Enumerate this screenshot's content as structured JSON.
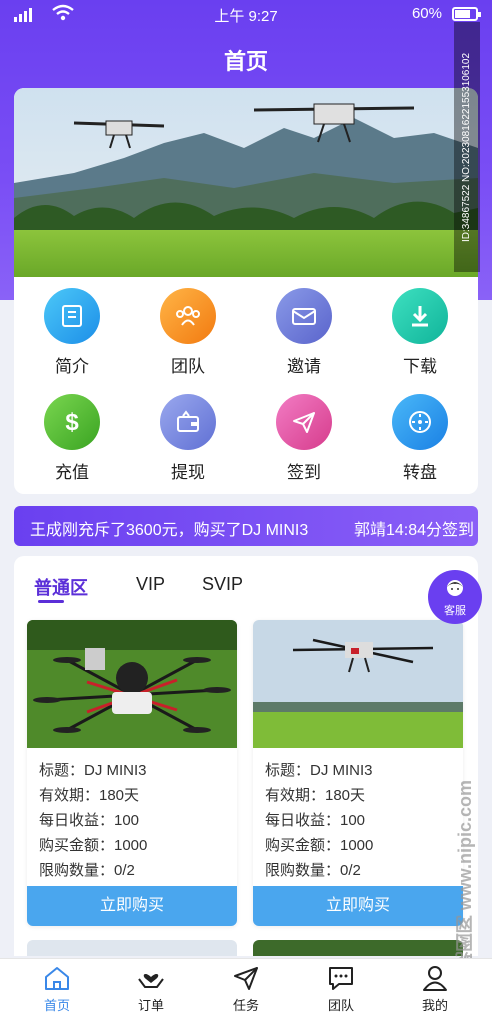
{
  "status_bar": {
    "time": "上午 9:27",
    "battery": "60%"
  },
  "page_title": "首页",
  "grid_items": [
    {
      "label": "简介",
      "icon": "document-icon",
      "color": "#29aaf0"
    },
    {
      "label": "团队",
      "icon": "team-icon",
      "color": "#f59a1e"
    },
    {
      "label": "邀请",
      "icon": "mail-icon",
      "color": "#6c7bd8"
    },
    {
      "label": "下载",
      "icon": "download-icon",
      "color": "#22ccb0"
    },
    {
      "label": "充值",
      "icon": "dollar-icon",
      "color": "#5cc43a"
    },
    {
      "label": "提现",
      "icon": "wallet-icon",
      "color": "#7b8ee0"
    },
    {
      "label": "签到",
      "icon": "send-icon",
      "color": "#e055a4"
    },
    {
      "label": "转盘",
      "icon": "wheel-icon",
      "color": "#2f9cf0"
    }
  ],
  "ticker": {
    "text1": "王成刚充斥了3600元，购买了DJ MINI3",
    "text2": "郭靖14:84分签到"
  },
  "tabs": [
    "普通区",
    "VIP",
    "SVIP"
  ],
  "products": [
    {
      "title": "标题：DJ MINI3",
      "validity": "有效期：180天",
      "daily": "每日收益：100",
      "amount": "购买金额：1000",
      "limit": "限购数量：0/2",
      "button": "立即购买"
    },
    {
      "title": "标题：DJ MINI3",
      "validity": "有效期：180天",
      "daily": "每日收益：100",
      "amount": "购买金额：1000",
      "limit": "限购数量：0/2",
      "button": "立即购买"
    }
  ],
  "service_label": "客服",
  "watermark": "ID:34867522 NO:20230816221553106102",
  "watermark2": "昵图网 www.nipic.com",
  "tabbar": [
    "首页",
    "订单",
    "任务",
    "团队",
    "我的"
  ],
  "colors": {
    "accent": "#6a3ff0",
    "buy_button": "#4aa6ee",
    "tab_active": "#3a88e8"
  }
}
